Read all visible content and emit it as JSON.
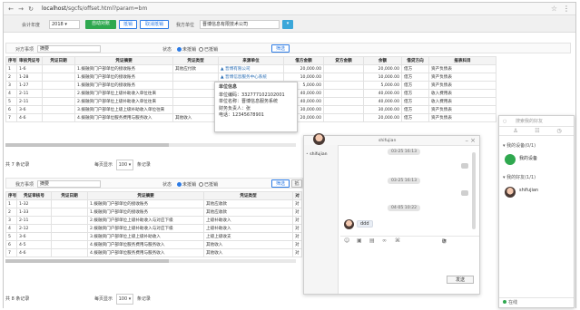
{
  "browser": {
    "url_host": "localhost",
    "url_path": "/sgcfs/offset.html?param=bm"
  },
  "toolbar": {
    "year_label": "会计年度",
    "year_value": "2018",
    "btn_auto": "自动对账",
    "btn_offset": "抵销",
    "btn_cancel": "取消抵销",
    "unit_label": "我方单位",
    "unit_value": "晋博信息有限技术公司",
    "btn_more": "▾"
  },
  "top_filter": {
    "label": "对方事项",
    "placeholder": "摘要",
    "status_label": "状态",
    "radio_unoffset": "未抵销",
    "radio_offset": "已抵销",
    "search_btn": "筛选"
  },
  "top_table": {
    "headers": [
      "序号",
      "审核凭证号",
      "凭证日期",
      "凭证摘要",
      "凭证类型",
      "来源单位",
      "借方金额",
      "贷方金额",
      "余额",
      "借贷方向",
      "报表科目"
    ],
    "rows": [
      [
        "1",
        "1-6",
        "",
        "1.拨融资门户部单位的接收账务",
        "其他应付款",
        "晋博有限公司",
        "20,000.00",
        "",
        "20,000.00",
        "借方",
        "资产负债表"
      ],
      [
        "2",
        "1-28",
        "",
        "1.拨融资门户部单位的接收账务",
        "",
        "晋博信息服务中心系统",
        "10,000.00",
        "",
        "10,000.00",
        "借方",
        "资产负债表"
      ],
      [
        "3",
        "1-27",
        "",
        "1.拨融资门户部单位的接收账务",
        "",
        "晋博信息服务中心系统",
        "5,000.00",
        "",
        "5,000.00",
        "借方",
        "资产负债表"
      ],
      [
        "4",
        "2-11",
        "",
        "2.拨融资门户部单位上级补助收入单位往来",
        "",
        "晋博信息服务有限",
        "40,000.00",
        "",
        "40,000.00",
        "借方",
        "收入费用表"
      ],
      [
        "5",
        "2-11",
        "",
        "2.拨融资门户部单位上级补助收入单位往来",
        "",
        "晋博信息服务中心系统",
        "40,000.00",
        "",
        "40,000.00",
        "借方",
        "收入费用表"
      ],
      [
        "6",
        "3-6",
        "",
        "3.拨融资门户部单位上级上级补助收入单位往来",
        "",
        "晋博信息服务中心系统",
        "30,000.00",
        "",
        "30,000.00",
        "借方",
        "资产负债表"
      ],
      [
        "7",
        "4-6",
        "",
        "4.拨融资门户部单位服务费用与服务收入",
        "其他收入",
        "晋博信息服务中心系统",
        "20,000.00",
        "",
        "20,000.00",
        "借方",
        "资产负债表"
      ]
    ],
    "footer_total": "共 7 条记录",
    "per_page_label": "每页显示",
    "per_page_value": "100",
    "per_page_suffix": "条记录"
  },
  "tooltip": {
    "title": "单位信息",
    "code": "单位编码：332777102102001",
    "name": "单位名称：晋博信息服务系统",
    "person": "财务负责人：张",
    "phone": "电话：12345678901"
  },
  "bottom_filter": {
    "label": "我方事项",
    "placeholder": "摘要",
    "status_label": "状态",
    "radio_unoffset": "未抵销",
    "radio_offset": "已抵销",
    "search_btn": "筛选",
    "extra_btn": "抵"
  },
  "bottom_table": {
    "headers": [
      "序号",
      "凭证审核号",
      "凭证日期",
      "凭证摘要",
      "凭证类型",
      "对"
    ],
    "rows": [
      [
        "1",
        "1-32",
        "",
        "1.拨融资门户部单位的接收账务",
        "其他应收款",
        "对"
      ],
      [
        "2",
        "1-33",
        "",
        "1.拨融资门户部单位的接收账务",
        "其他应收款",
        "对"
      ],
      [
        "3",
        "2-11",
        "",
        "2.拨融资门户部单位上级补助收入与对应下级",
        "上级补助收入",
        "对"
      ],
      [
        "4",
        "2-12",
        "",
        "2.拨融资门户部单位上级补助收入与对应下级",
        "上级补助收入",
        "对"
      ],
      [
        "5",
        "3-6",
        "",
        "3.拨融资门户部单位上级上级补助收入",
        "上级上级收支",
        "对"
      ],
      [
        "6",
        "4-5",
        "",
        "4.拨融资门户部单位服务费用与服务收入",
        "其他收入",
        "对"
      ],
      [
        "7",
        "4-6",
        "",
        "4.拨融资门户部单位服务费用与服务收入",
        "其他收入",
        "对"
      ]
    ],
    "footer_total": "共 8 条记录",
    "per_page_label": "每页显示",
    "per_page_value": "100",
    "per_page_suffix": "条记录"
  },
  "chat": {
    "left_name": "shifujian",
    "contact_name": "shifujian",
    "times": [
      "03-25 16:13",
      "03-25 16:13",
      "04-05 10:22"
    ],
    "incoming_text": "ddd",
    "history_link": "聊天记录",
    "send_label": "发送"
  },
  "im": {
    "title": "搜索我的好友",
    "group1": "我的设备(0/1)",
    "friend1": "我的设备",
    "group2": "我的好友(1/1)",
    "friend2": "shifujian",
    "status": "在线"
  }
}
